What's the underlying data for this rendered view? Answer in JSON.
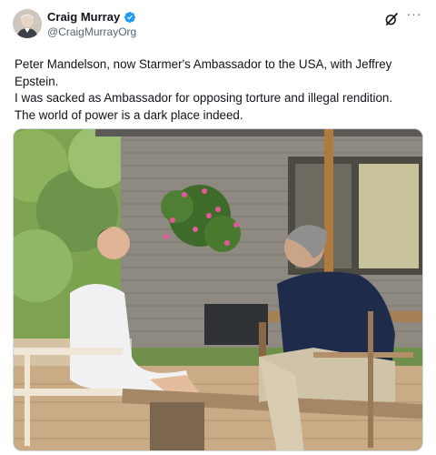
{
  "author": {
    "display_name": "Craig Murray",
    "handle": "@CraigMurrayOrg",
    "verified_icon": "verified-badge-icon",
    "verified_color": "#1d9bf0"
  },
  "actions": {
    "grok_icon": "grok-icon",
    "more_icon": "more-options-icon",
    "more_label": "···"
  },
  "tweet": {
    "lines": [
      "Peter Mandelson, now Starmer's Ambassador to the USA, with Jeffrey Epstein.",
      "I was sacked as Ambassador for opposing torture and illegal rendition.",
      "The world of power is a dark place indeed."
    ]
  },
  "media": {
    "type": "photo",
    "icon": "photo-image"
  }
}
